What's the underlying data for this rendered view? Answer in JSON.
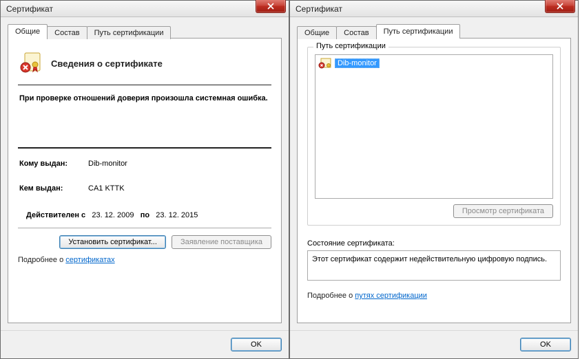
{
  "left": {
    "title": "Сертификат",
    "tabs": {
      "general": "Общие",
      "details": "Состав",
      "path": "Путь сертификации"
    },
    "heading": "Сведения о сертификате",
    "error": "При проверке отношений доверия произошла системная ошибка.",
    "issued_to_label": "Кому выдан:",
    "issued_to": "Dib-monitor",
    "issued_by_label": "Кем выдан:",
    "issued_by": "CA1 KTTK",
    "valid_from_label": "Действителен с",
    "valid_from": "23. 12. 2009",
    "valid_to_label": "по",
    "valid_to": "23. 12. 2015",
    "install_btn": "Установить сертификат...",
    "issuer_stmt_btn": "Заявление поставщика",
    "learn_prefix": "Подробнее о ",
    "learn_link": "сертификатах",
    "ok": "OK"
  },
  "right": {
    "title": "Сертификат",
    "tabs": {
      "general": "Общие",
      "details": "Состав",
      "path": "Путь сертификации"
    },
    "group_title": "Путь сертификации",
    "node": "Dib-monitor",
    "view_cert_btn": "Просмотр сертификата",
    "status_label": "Состояние сертификата:",
    "status_text": "Этот сертификат содержит недействительную цифровую подпись.",
    "learn_prefix": "Подробнее о ",
    "learn_link": "путях сертификации",
    "ok": "OK"
  }
}
